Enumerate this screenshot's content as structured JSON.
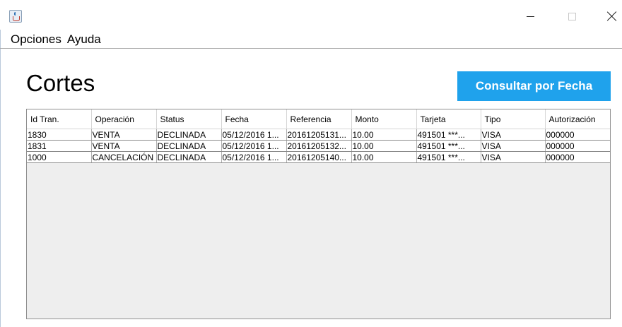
{
  "window": {
    "title": ""
  },
  "menu": {
    "items": [
      "Opciones",
      "Ayuda"
    ]
  },
  "page": {
    "title": "Cortes",
    "consult_button": "Consultar por Fecha"
  },
  "table": {
    "columns": [
      "Id Tran.",
      "Operación",
      "Status",
      "Fecha",
      "Referencia",
      "Monto",
      "Tarjeta",
      "Tipo",
      "Autorización"
    ],
    "rows": [
      [
        "1830",
        "VENTA",
        "DECLINADA",
        "05/12/2016 1...",
        "20161205131...",
        "10.00",
        "491501 ***...",
        "VISA",
        "000000"
      ],
      [
        "1831",
        "VENTA",
        "DECLINADA",
        "05/12/2016 1...",
        "20161205132...",
        "10.00",
        "491501 ***...",
        "VISA",
        "000000"
      ],
      [
        "1000",
        "CANCELACIÓN",
        "DECLINADA",
        "05/12/2016 1...",
        "20161205140...",
        "10.00",
        "491501 ***...",
        "VISA",
        "000000"
      ]
    ]
  },
  "colors": {
    "button_bg": "#1fa2ec",
    "button_text": "#ffffff",
    "table_empty_bg": "#eeeeee"
  },
  "icons": {
    "app": "java-cup-icon",
    "minimize": "minimize-icon",
    "maximize": "maximize-icon",
    "close": "close-icon"
  }
}
